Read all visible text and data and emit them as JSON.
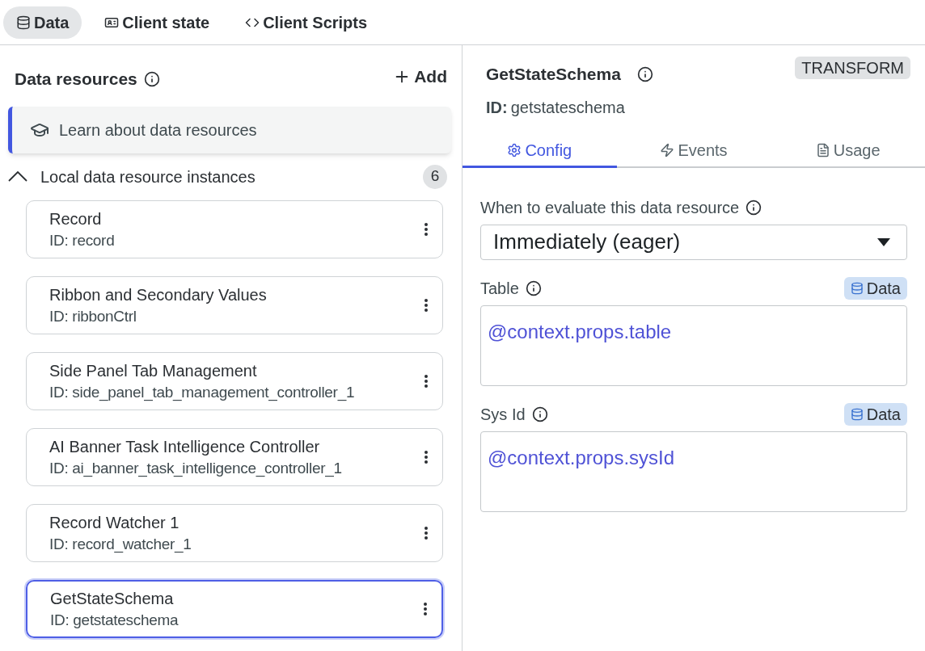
{
  "top_tabs": [
    {
      "label": "Data",
      "kind": "data",
      "selected": true
    },
    {
      "label": "Client state",
      "kind": "state",
      "selected": false
    },
    {
      "label": "Client Scripts",
      "kind": "scripts",
      "selected": false
    }
  ],
  "sidebar": {
    "title": "Data resources",
    "add_label": "Add",
    "learn_link": "Learn about data resources",
    "section": {
      "label": "Local data resource instances",
      "expanded": true,
      "count": "6"
    },
    "resources": [
      {
        "name": "Record",
        "id": "ID: record",
        "selected": false
      },
      {
        "name": "Ribbon and Secondary Values",
        "id": "ID: ribbonCtrl",
        "selected": false
      },
      {
        "name": "Side Panel Tab Management",
        "id": "ID: side_panel_tab_management_controller_1",
        "selected": false
      },
      {
        "name": "AI Banner Task Intelligence Controller",
        "id": "ID: ai_banner_task_intelligence_controller_1",
        "selected": false
      },
      {
        "name": "Record Watcher 1",
        "id": "ID: record_watcher_1",
        "selected": false
      },
      {
        "name": "GetStateSchema",
        "id": "ID: getstateschema",
        "selected": true
      }
    ]
  },
  "detail": {
    "title": "GetStateSchema",
    "id_label": "ID:",
    "id_value": "getstateschema",
    "type_badge": "TRANSFORM",
    "tabs": [
      {
        "label": "Config",
        "kind": "config",
        "selected": true
      },
      {
        "label": "Events",
        "kind": "events",
        "selected": false
      },
      {
        "label": "Usage",
        "kind": "usage",
        "selected": false
      }
    ],
    "evaluate": {
      "label": "When to evaluate this data resource",
      "value": "Immediately (eager)"
    },
    "fields": [
      {
        "label": "Table",
        "badge": "Data",
        "value": "@context.props.table"
      },
      {
        "label": "Sys Id",
        "badge": "Data",
        "value": "@context.props.sysId"
      }
    ]
  }
}
